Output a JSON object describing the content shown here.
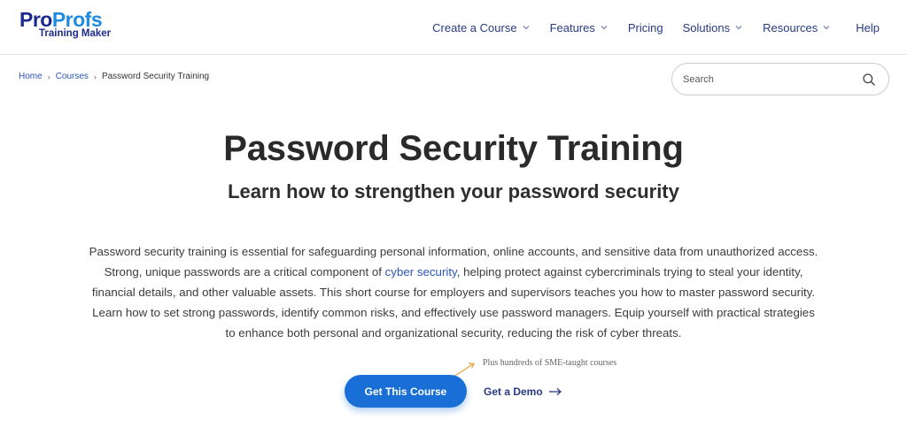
{
  "brand": {
    "logo_pro": "Pro",
    "logo_profs": "Profs",
    "logo_sub": "Training Maker",
    "primary_color": "#1a6fd6",
    "nav_color": "#273a84"
  },
  "nav": {
    "items": [
      {
        "label": "Create a Course",
        "has_dropdown": true
      },
      {
        "label": "Features",
        "has_dropdown": true
      },
      {
        "label": "Pricing",
        "has_dropdown": false
      },
      {
        "label": "Solutions",
        "has_dropdown": true
      },
      {
        "label": "Resources",
        "has_dropdown": true
      },
      {
        "label": "Help",
        "has_dropdown": false
      }
    ]
  },
  "breadcrumb": {
    "home": "Home",
    "courses": "Courses",
    "current": "Password Security Training",
    "separator": "›"
  },
  "search": {
    "placeholder": "Search",
    "value": ""
  },
  "hero": {
    "title": "Password Security Training",
    "subtitle": "Learn how to strengthen your password security",
    "desc_line1": "Password security training is essential for safeguarding personal information, online accounts, and sensitive data from unauthorized access.",
    "desc_line2_pre": "Strong, unique passwords are a critical component of ",
    "desc_link": "cyber security",
    "desc_line2_post": ", helping protect against cybercriminals trying to steal your identity,",
    "desc_line3": "financial details, and other valuable assets. This short course for employers and supervisors teaches you how to master password security.",
    "desc_line4": "Learn how to set strong passwords, identify common risks, and effectively use password managers. Equip yourself with practical strategies",
    "desc_line5": "to enhance both personal and organizational security, reducing the risk of cyber threats."
  },
  "cta": {
    "note": "Plus hundreds of SME-taught courses",
    "primary_label": "Get This Course",
    "demo_label": "Get a Demo"
  }
}
